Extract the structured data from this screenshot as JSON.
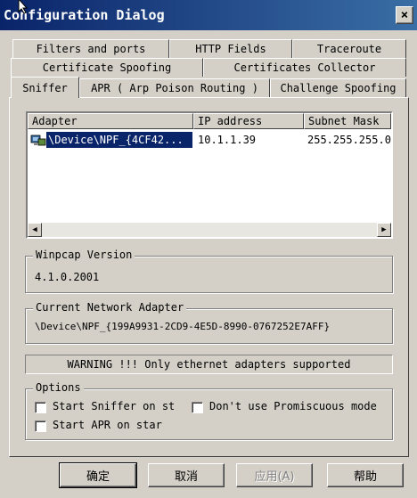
{
  "window": {
    "title": "Configuration Dialog",
    "close_label": "×"
  },
  "tabs": {
    "row1": [
      "Filters and ports",
      "HTTP Fields",
      "Traceroute"
    ],
    "row2": [
      "Certificate Spoofing",
      "Certificates Collector"
    ],
    "row3": [
      "Sniffer",
      "APR ( Arp Poison Routing )",
      "Challenge Spoofing"
    ]
  },
  "adapters": {
    "columns": [
      "Adapter",
      "IP address",
      "Subnet Mask"
    ],
    "rows": [
      {
        "adapter": "\\Device\\NPF_{4CF42...",
        "ip": "10.1.1.39",
        "mask": "255.255.255.0",
        "icon": "network-adapter-icon"
      }
    ]
  },
  "winpcap": {
    "label": "Winpcap Version",
    "value": "4.1.0.2001"
  },
  "current_adapter": {
    "label": "Current Network Adapter",
    "value": "\\Device\\NPF_{199A9931-2CD9-4E5D-8990-0767252E7AFF}"
  },
  "warning": "WARNING !!! Only ethernet adapters supported",
  "options": {
    "label": "Options",
    "start_sniffer": "Start Sniffer on st",
    "no_promiscuous": "Don't use Promiscuous mode",
    "start_apr": "Start APR on star"
  },
  "buttons": {
    "ok": "确定",
    "cancel": "取消",
    "apply": "应用(A)",
    "help": "帮助"
  },
  "colors": {
    "title_bar": "#0a246a",
    "selection": "#0a246a",
    "face": "#d4d0c8"
  }
}
